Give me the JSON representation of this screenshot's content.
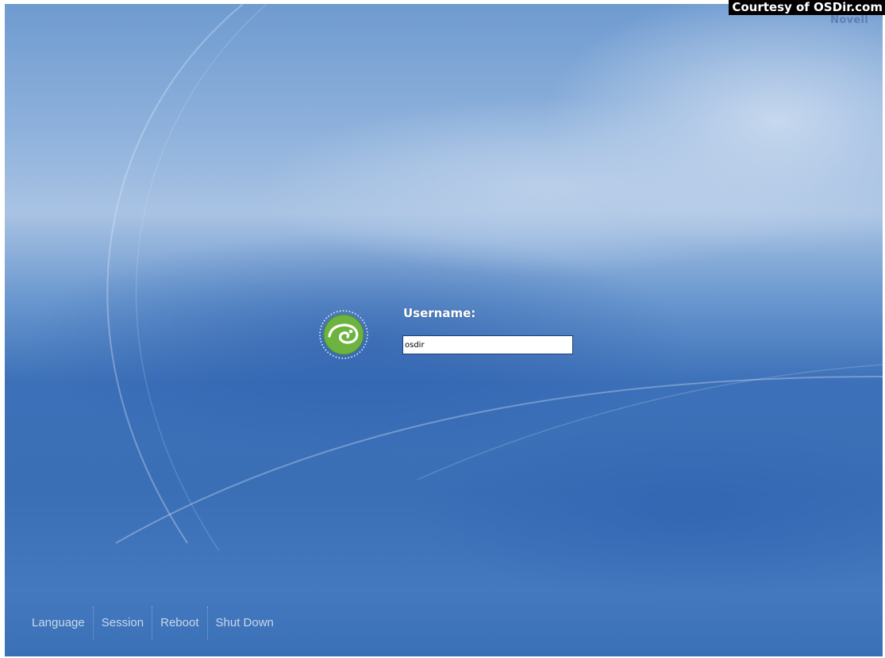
{
  "watermark": "Courtesy of OSDir.com",
  "brand": {
    "vendor": "Novell"
  },
  "login": {
    "username_label": "Username:",
    "username_value": "osdir",
    "logo_icon": "opensuse-gecko-icon"
  },
  "bottom_bar": {
    "language": "Language",
    "session": "Session",
    "reboot": "Reboot",
    "shutdown": "Shut Down"
  },
  "colors": {
    "background_blue": "#3c70b8",
    "light_blue": "#a9c3e3",
    "logo_green": "#6db33f",
    "bottom_text": "#c9d8ec"
  }
}
